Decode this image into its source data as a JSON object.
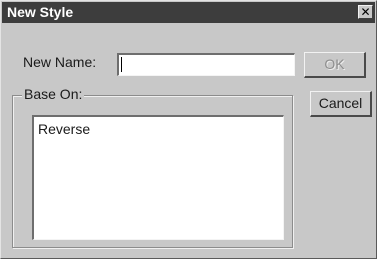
{
  "window": {
    "title": "New Style",
    "close_glyph": "✕"
  },
  "form": {
    "name_label": "New Name:",
    "name_value": "",
    "base_label": "Base On:",
    "base_items": [
      "Reverse"
    ]
  },
  "buttons": {
    "ok": "OK",
    "cancel": "Cancel"
  }
}
